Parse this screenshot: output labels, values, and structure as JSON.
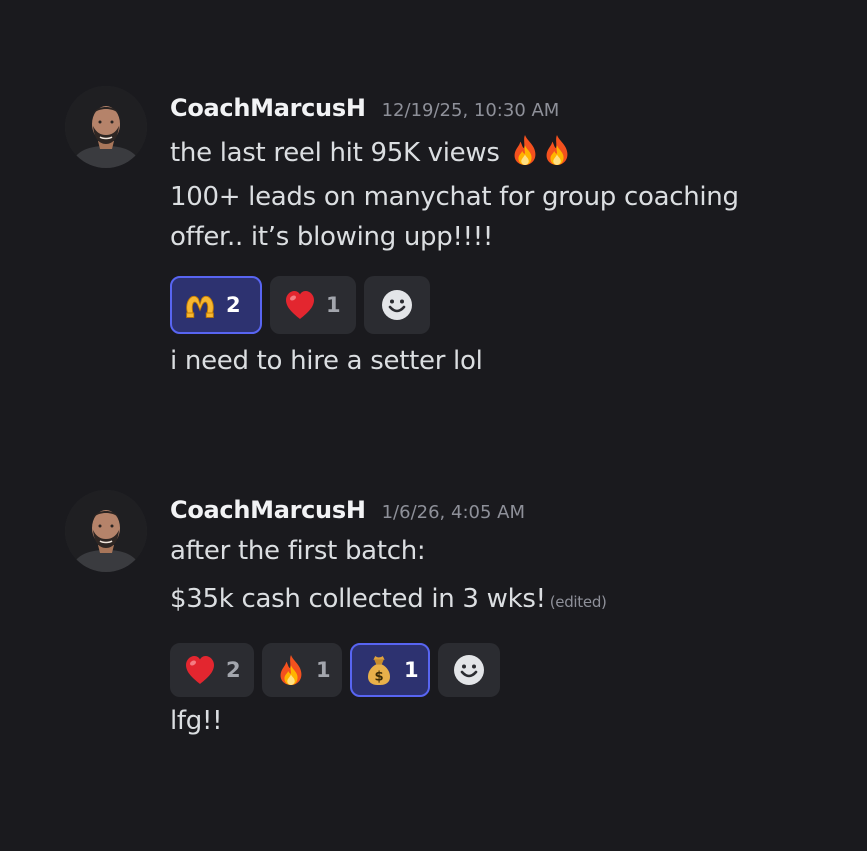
{
  "messages": [
    {
      "username": "CoachMarcusH",
      "timestamp": "12/19/25, 10:30 AM",
      "line1": "the last reel hit 95K views",
      "line2": "100+ leads on manychat for group coaching",
      "line3": "offer.. it’s blowing upp!!!!",
      "reactions": [
        {
          "emoji": "heart-hands-emoji",
          "count": "2",
          "active": true
        },
        {
          "emoji": "red-heart-emoji",
          "count": "1",
          "active": false
        }
      ],
      "line4": "i need to hire a setter lol"
    },
    {
      "username": "CoachMarcusH",
      "timestamp": "1/6/26, 4:05 AM",
      "line1": "after the first batch:",
      "line2": "$35k cash collected in 3 wks!",
      "edited": "(edited)",
      "reactions": [
        {
          "emoji": "red-heart-emoji",
          "count": "2",
          "active": false
        },
        {
          "emoji": "fire-emoji",
          "count": "1",
          "active": false
        },
        {
          "emoji": "money-bag-emoji",
          "count": "1",
          "active": true
        }
      ],
      "line3": "lfg!!"
    }
  ],
  "colors": {
    "background": "#1a1a1e",
    "reaction_bg": "#2b2c31",
    "reaction_active_bg": "#2d3270",
    "reaction_active_border": "#5865f2",
    "text": "#dbdee1",
    "muted": "#8e9099"
  }
}
